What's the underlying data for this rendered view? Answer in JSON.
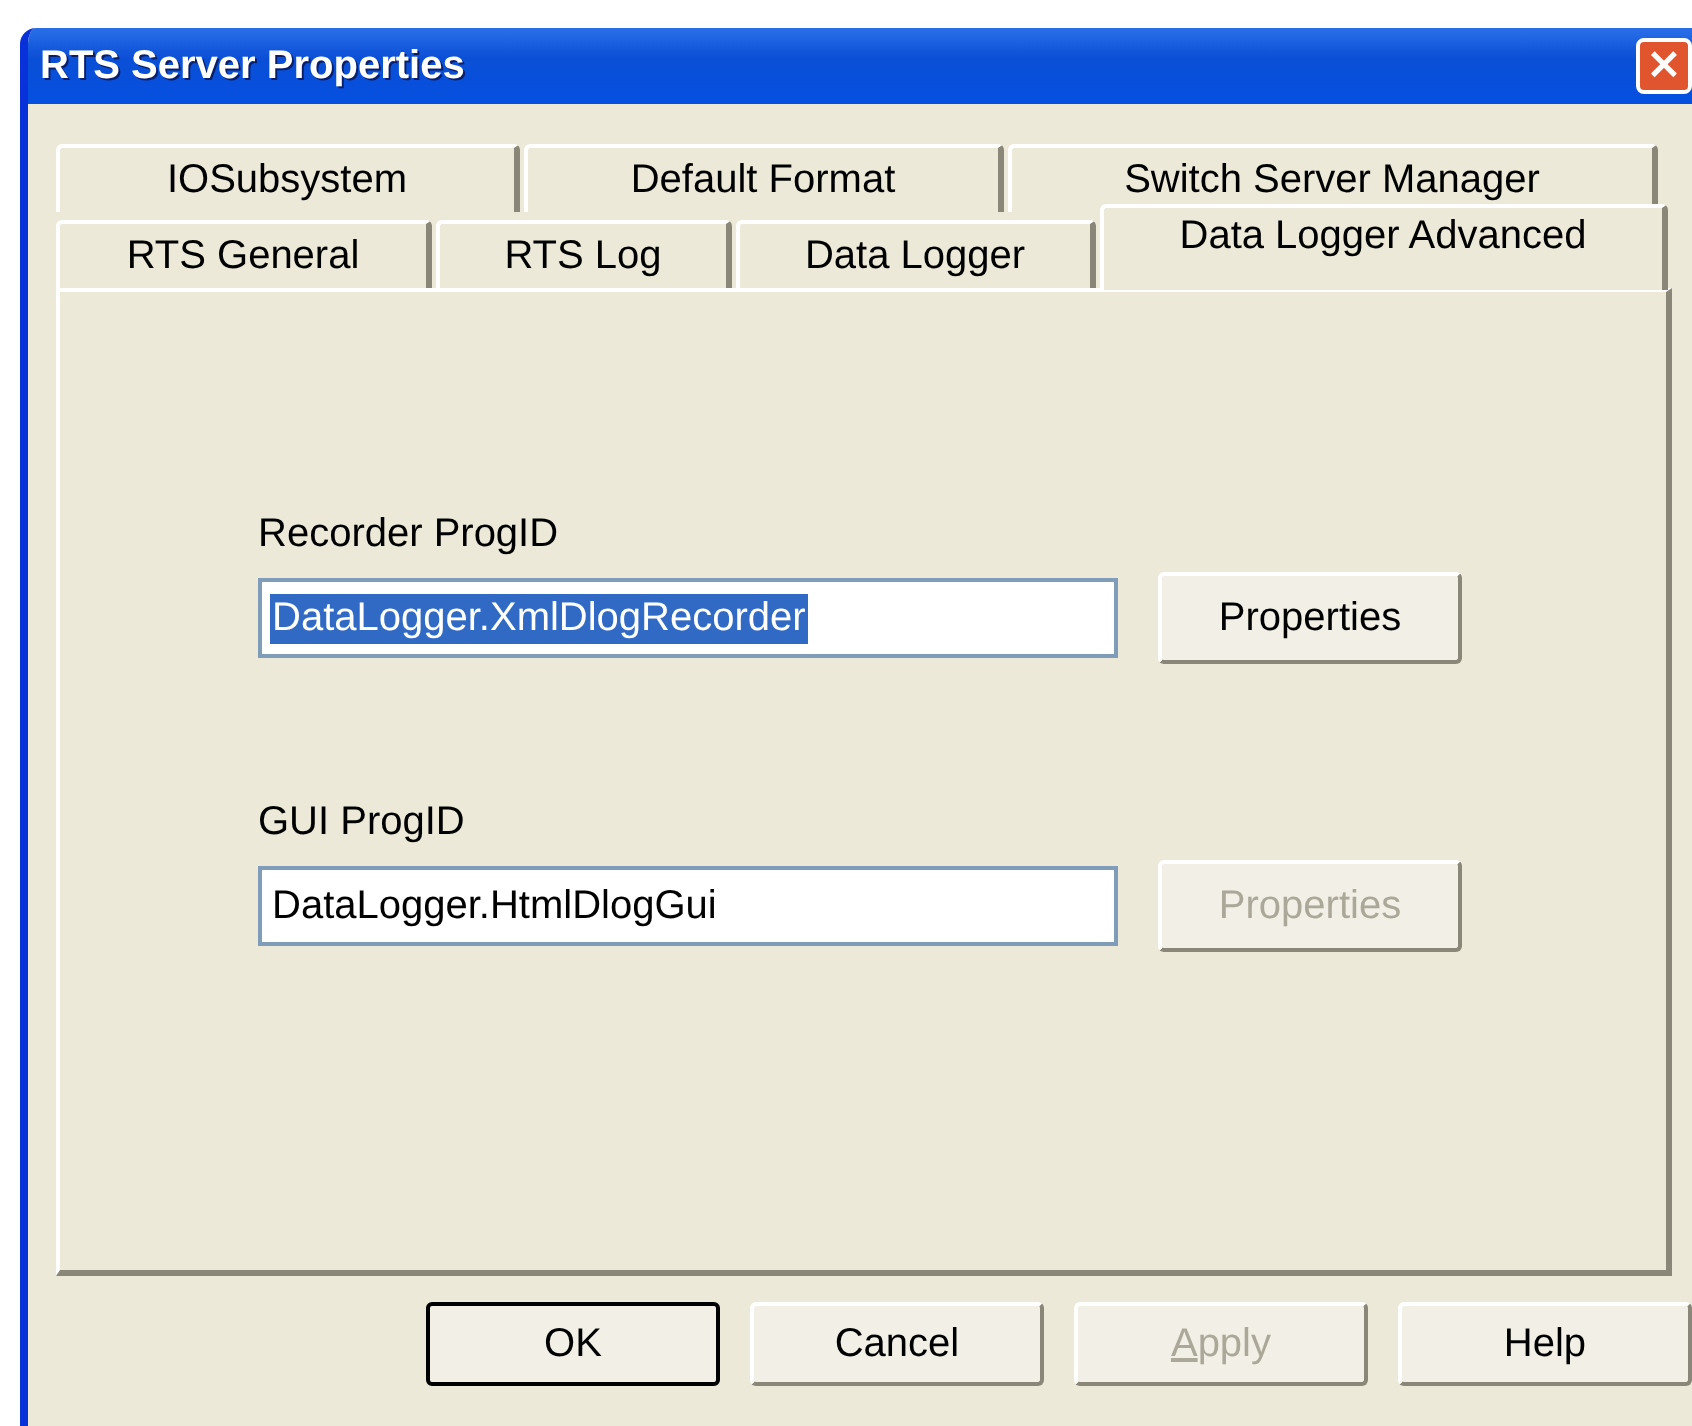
{
  "window": {
    "title": "RTS Server Properties",
    "close": "×"
  },
  "tab_rows": [
    {
      "tabs": [
        {
          "label": "IOSubsystem",
          "selected": false
        },
        {
          "label": "Default Format",
          "selected": false
        },
        {
          "label": "Switch Server Manager",
          "selected": false
        }
      ]
    },
    {
      "tabs": [
        {
          "label": "RTS General",
          "selected": false
        },
        {
          "label": "RTS Log",
          "selected": false
        },
        {
          "label": "Data Logger",
          "selected": false
        },
        {
          "label": "Data Logger Advanced",
          "selected": true
        }
      ]
    }
  ],
  "fields": [
    {
      "label": "Recorder ProgID",
      "value": "DataLogger.XmlDlogRecorder",
      "text_selected": true,
      "button": {
        "label": "Properties",
        "disabled": false
      }
    },
    {
      "label": "GUI ProgID",
      "value": "DataLogger.HtmlDlogGui",
      "text_selected": false,
      "button": {
        "label": "Properties",
        "disabled": true
      }
    }
  ],
  "buttons": [
    {
      "label": "OK",
      "default": true,
      "disabled": false,
      "mnemonic": false
    },
    {
      "label": "Cancel",
      "default": false,
      "disabled": false,
      "mnemonic": false
    },
    {
      "label": "Apply",
      "default": false,
      "disabled": true,
      "mnemonic": true
    },
    {
      "label": "Help",
      "default": false,
      "disabled": false,
      "mnemonic": false
    }
  ]
}
